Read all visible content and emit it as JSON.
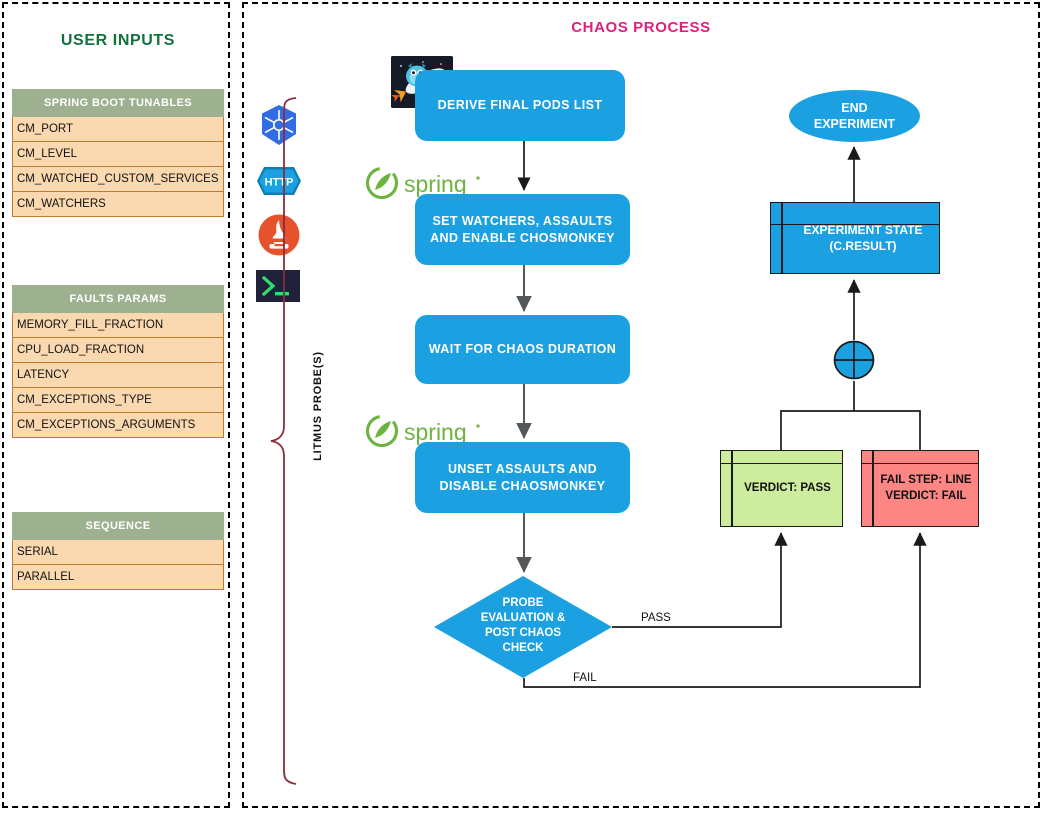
{
  "left_panel": {
    "title": "USER INPUTS",
    "tables": [
      {
        "name": "spring-boot-tunables",
        "header": "SPRING BOOT TUNABLES",
        "rows": [
          "CM_PORT",
          "CM_LEVEL",
          "CM_WATCHED_CUSTOM_SERVICES",
          "CM_WATCHERS"
        ]
      },
      {
        "name": "faults-params",
        "header": "FAULTS PARAMS",
        "rows": [
          "MEMORY_FILL_FRACTION",
          "CPU_LOAD_FRACTION",
          "LATENCY",
          "CM_EXCEPTIONS_TYPE",
          "CM_EXCEPTIONS_ARGUMENTS"
        ]
      },
      {
        "name": "sequence",
        "header": "SEQUENCE",
        "rows": [
          "SERIAL",
          "PARALLEL"
        ]
      }
    ]
  },
  "right_panel": {
    "title": "CHAOS PROCESS",
    "probe_label": "LITMUS PROBE(S)",
    "probe_icons": [
      {
        "name": "kubernetes-icon",
        "label": ""
      },
      {
        "name": "http-icon",
        "label": "HTTP"
      },
      {
        "name": "prometheus-icon",
        "label": ""
      },
      {
        "name": "terminal-icon",
        "label": ">_"
      }
    ],
    "logos": [
      {
        "name": "litmus-logo",
        "label": ""
      },
      {
        "name": "spring-logo",
        "label": "spring"
      },
      {
        "name": "spring-logo",
        "label": "spring"
      }
    ],
    "steps": [
      {
        "id": "derive",
        "label": "DERIVE FINAL PODS LIST"
      },
      {
        "id": "set_watchers",
        "label": "SET WATCHERS, ASSAULTS AND ENABLE CHOSMONKEY"
      },
      {
        "id": "wait",
        "label": "WAIT FOR CHAOS DURATION"
      },
      {
        "id": "unset",
        "label": "UNSET ASSAULTS AND DISABLE CHAOSMONKEY"
      }
    ],
    "decision": {
      "id": "probe_eval",
      "lines": [
        "PROBE",
        "EVALUATION &",
        "POST CHAOS",
        "CHECK"
      ]
    },
    "edge_labels": {
      "pass": "PASS",
      "fail": "FAIL"
    },
    "verdict_pass": "VERDICT: PASS",
    "verdict_fail_line1": "FAIL STEP: LINE",
    "verdict_fail_line2": "VERDICT: FAIL",
    "experiment_state_line1": "EXPERIMENT STATE",
    "experiment_state_line2": "(C.RESULT)",
    "end_experiment_line1": "END",
    "end_experiment_line2": "EXPERIMENT"
  },
  "colors": {
    "blue": "#1BA1E2",
    "green_header": "#9DB08F",
    "peach_row": "#FBD9B0",
    "row_border": "#C07C2A",
    "pass_green": "#CDEC9D",
    "fail_red": "#FB8684",
    "title_green": "#11723E",
    "title_pink": "#E01E7E",
    "brace_maroon": "#8C2B3A",
    "spring_green": "#6DB33F"
  }
}
